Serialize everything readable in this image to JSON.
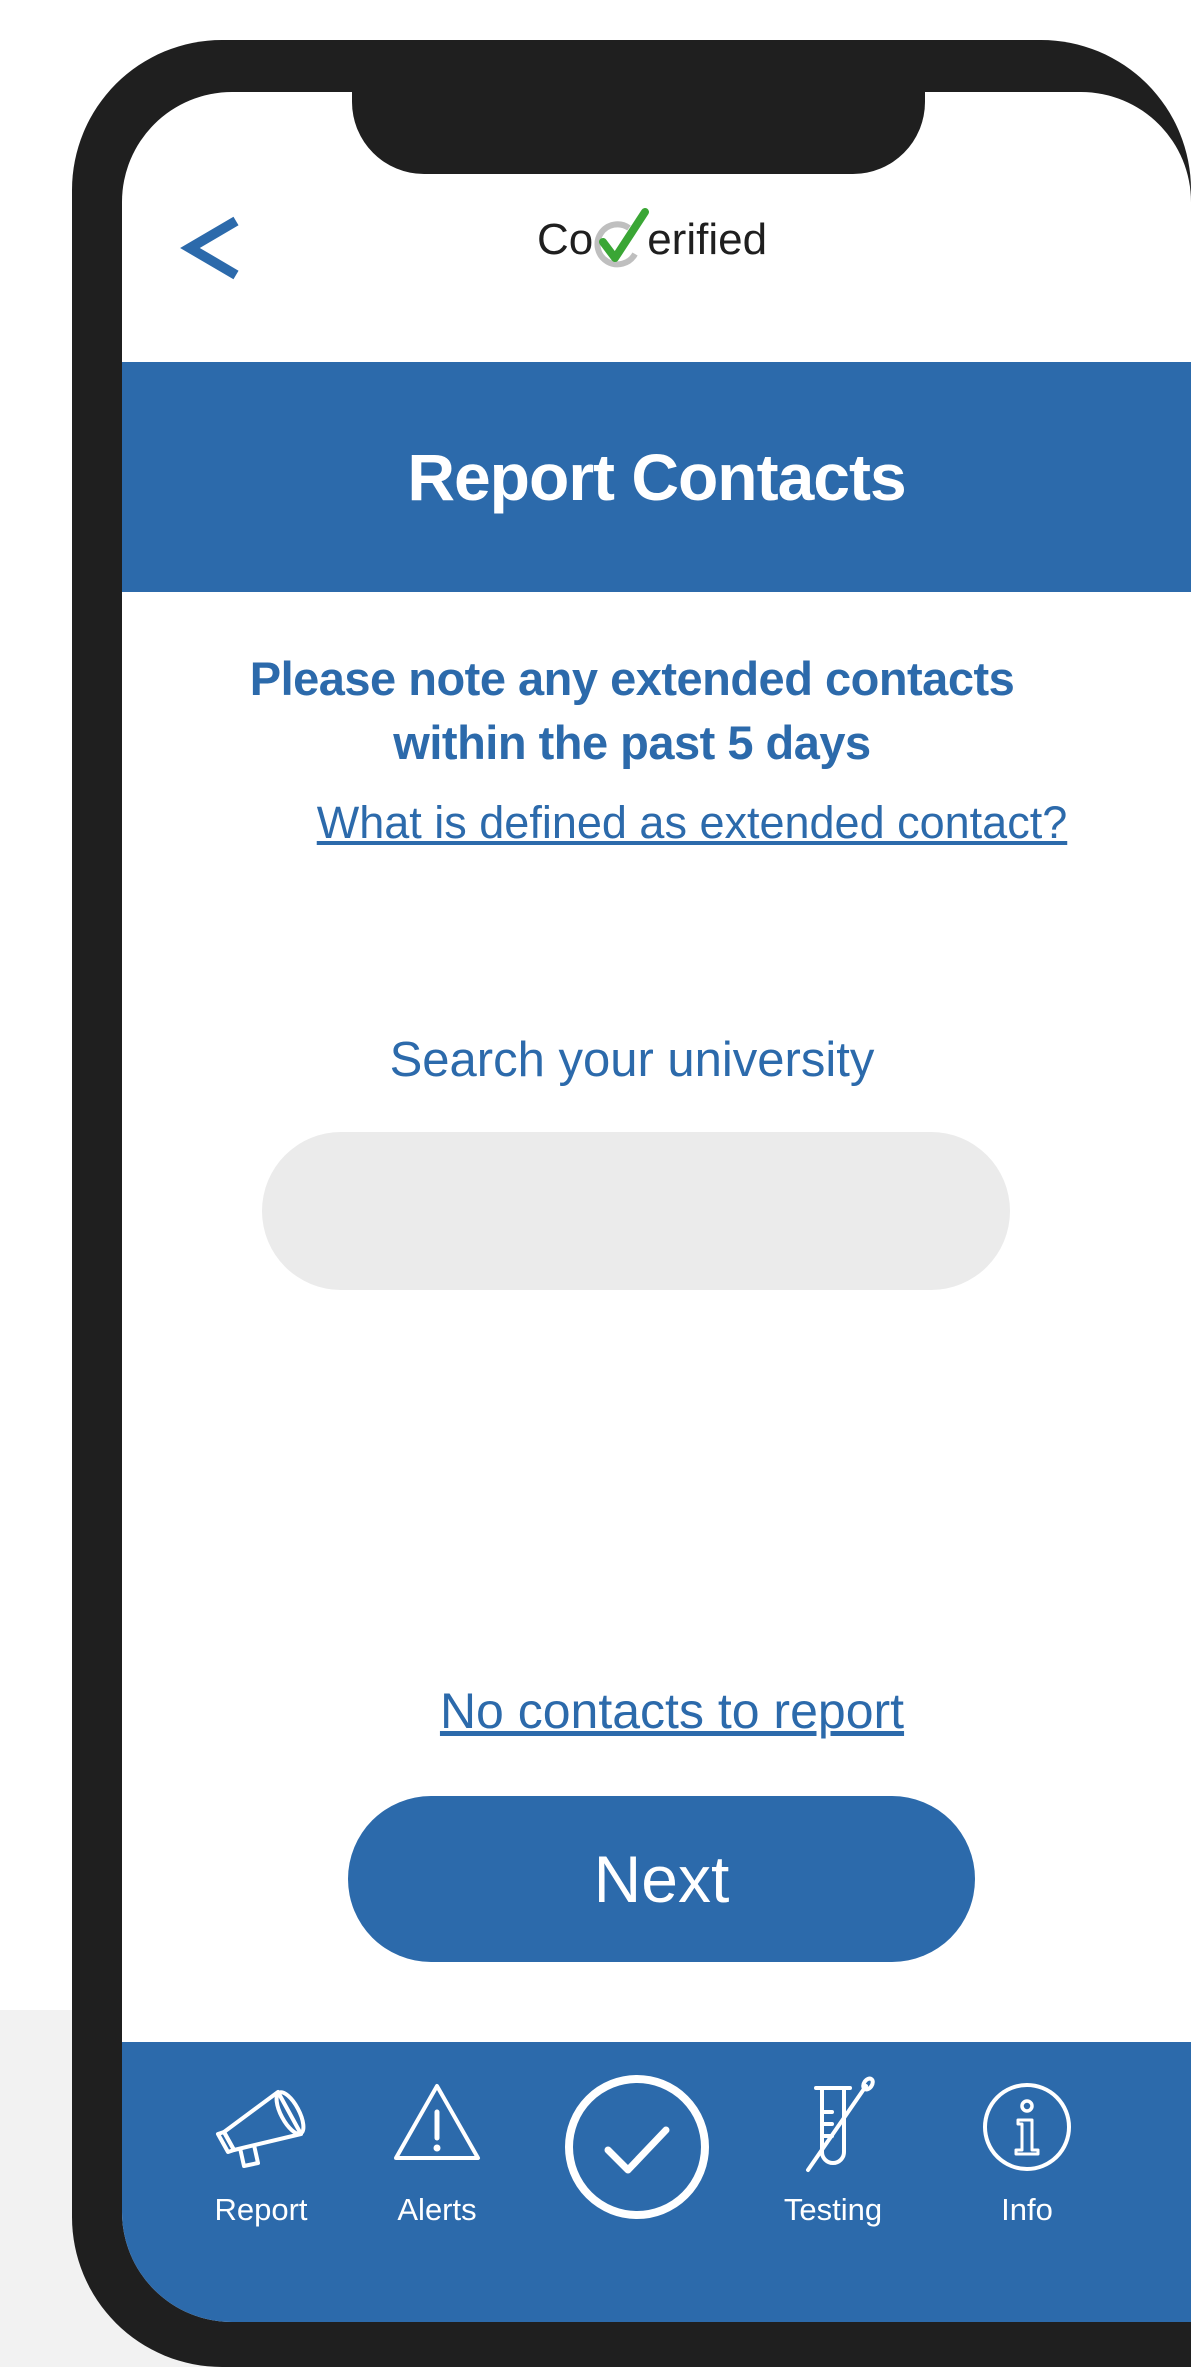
{
  "app": {
    "brand_prefix": "Co",
    "brand_suffix": "erified"
  },
  "header": {
    "title": "Report Contacts"
  },
  "content": {
    "note_line1": "Please note any extended contacts",
    "note_line2": "within the past 5 days",
    "definition_link": "What is defined as extended contact?",
    "search_label": "Search your university",
    "search_value": "",
    "search_placeholder": "",
    "no_contacts_link": "No contacts to report",
    "next_label": "Next"
  },
  "tabbar": {
    "items": [
      {
        "label": "Report",
        "icon": "megaphone-icon"
      },
      {
        "label": "Alerts",
        "icon": "warning-icon"
      },
      {
        "label": "",
        "icon": "check-circle-icon"
      },
      {
        "label": "Testing",
        "icon": "test-tube-icon"
      },
      {
        "label": "Info",
        "icon": "info-icon"
      }
    ]
  },
  "colors": {
    "brand_blue": "#2c6aab",
    "check_green": "#3aa635",
    "frame": "#1f1f1f",
    "input_bg": "#ebebeb"
  }
}
